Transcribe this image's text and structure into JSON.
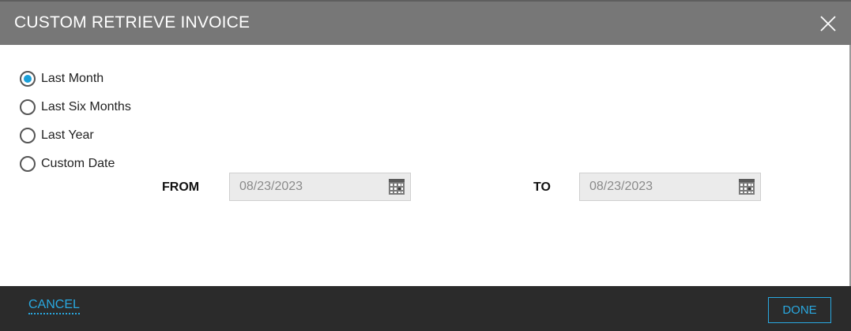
{
  "dialog": {
    "title": "CUSTOM RETRIEVE INVOICE",
    "close_icon": "close-icon"
  },
  "range_options": [
    {
      "label": "Last Month",
      "checked": true
    },
    {
      "label": "Last Six Months",
      "checked": false
    },
    {
      "label": "Last Year",
      "checked": false
    },
    {
      "label": "Custom Date",
      "checked": false
    }
  ],
  "date_range": {
    "from_label": "FROM",
    "from_value": "08/23/2023",
    "to_label": "TO",
    "to_value": "08/23/2023",
    "calendar_icon": "calendar-icon"
  },
  "footer": {
    "cancel_label": "CANCEL",
    "done_label": "DONE"
  },
  "colors": {
    "header_bg": "#777777",
    "footer_bg": "#2b2b2b",
    "accent": "#29a8e0",
    "radio_selected": "#1a9fd8",
    "field_bg": "#ebebeb"
  }
}
